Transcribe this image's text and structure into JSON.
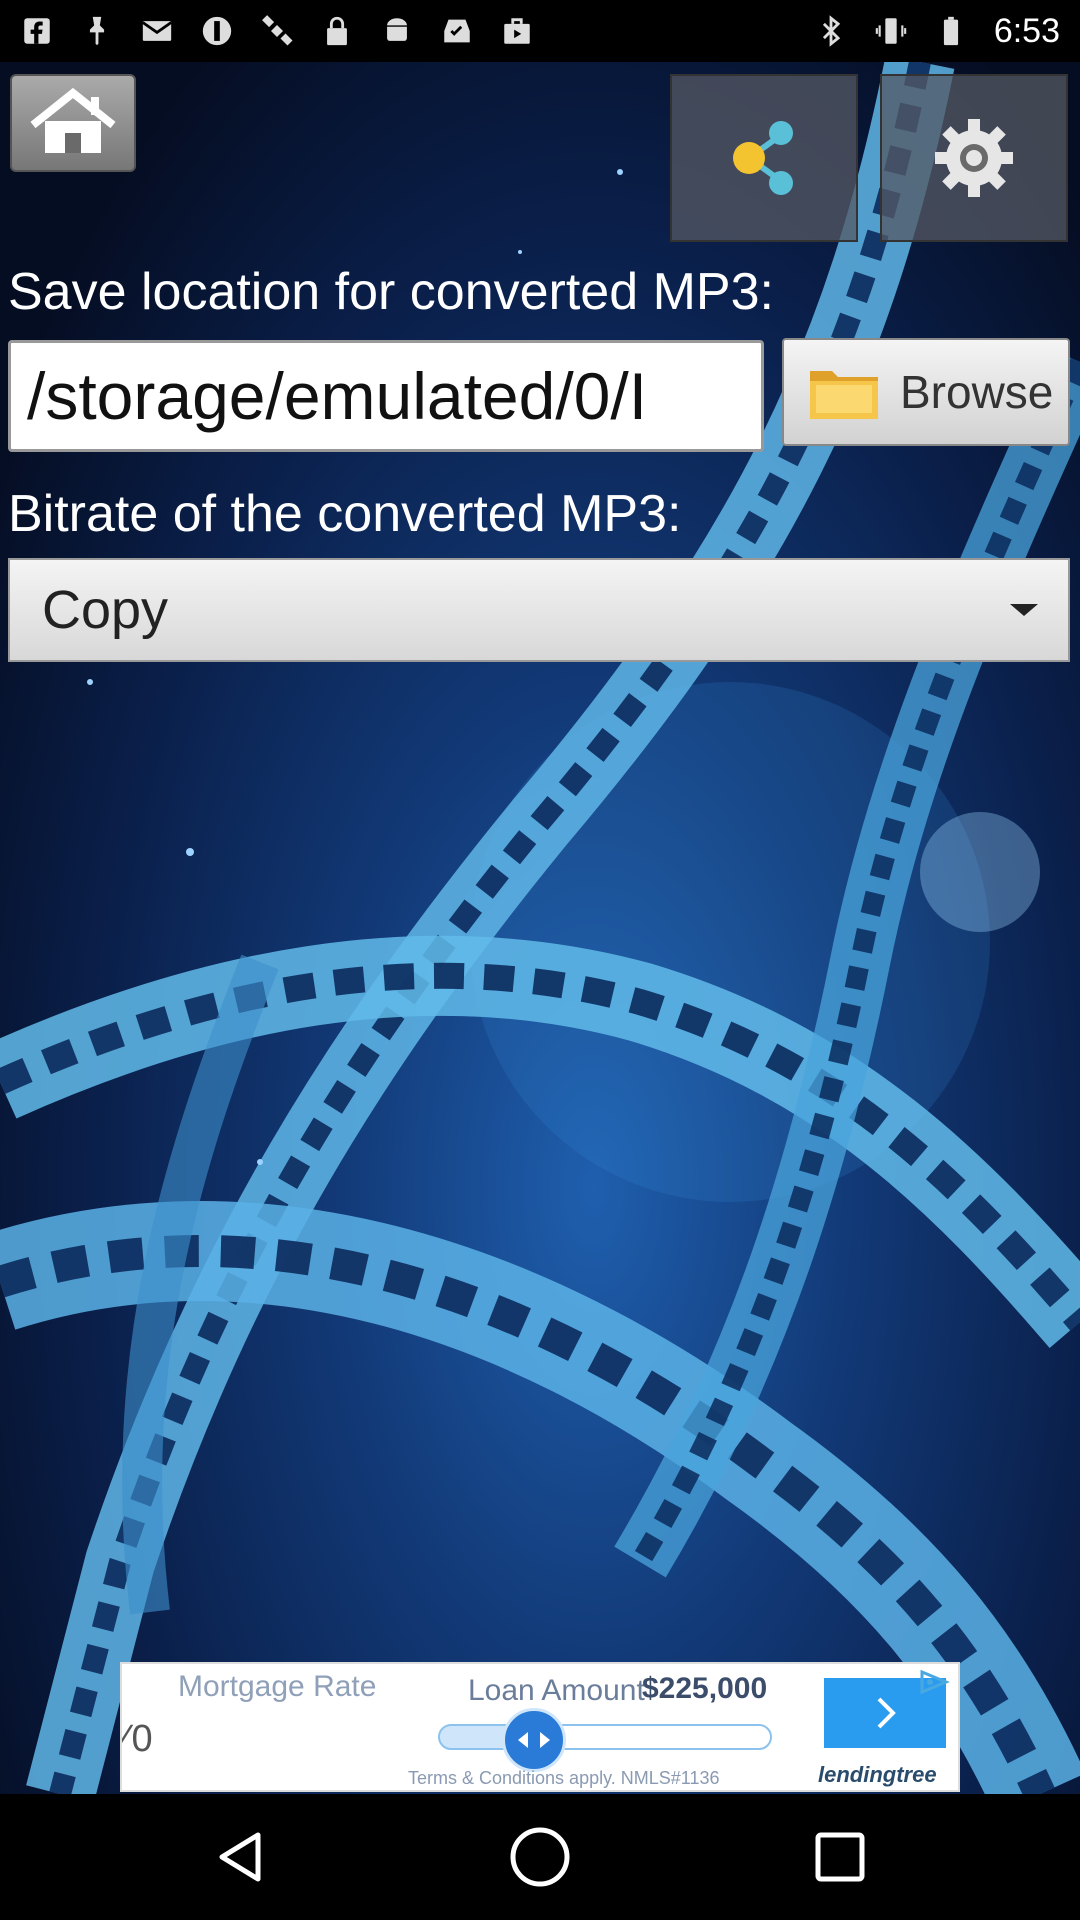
{
  "status_bar": {
    "time": "6:53",
    "left_icons": [
      "facebook-icon",
      "pin-icon",
      "mail-icon",
      "blocked-icon",
      "satellite-fake-gps-icon",
      "lock-icon",
      "android-icon",
      "inbox-icon",
      "play-store-icon"
    ],
    "right_icons": [
      "bluetooth-icon",
      "vibrate-icon",
      "battery-icon"
    ]
  },
  "toolbar": {
    "home": "home-icon",
    "share": "share-icon",
    "settings": "gear-icon"
  },
  "save_location": {
    "label": "Save location for converted MP3:",
    "path_value": "/storage/emulated/0/I",
    "browse_label": "Browse"
  },
  "bitrate": {
    "label": "Bitrate of the converted MP3:",
    "selected": "Copy"
  },
  "ad": {
    "mortgage_label": "Mortgage Rate",
    "loan_label": "Loan Amount",
    "loan_value": "$225,000",
    "rate_fragment": "⁄ 0",
    "terms": "Terms & Conditions apply. NMLS#1136",
    "brand": "lendingtree",
    "slider_position": 0.25
  },
  "colors": {
    "accent_blue": "#2a9cf0",
    "background_blue": "#123a78"
  }
}
